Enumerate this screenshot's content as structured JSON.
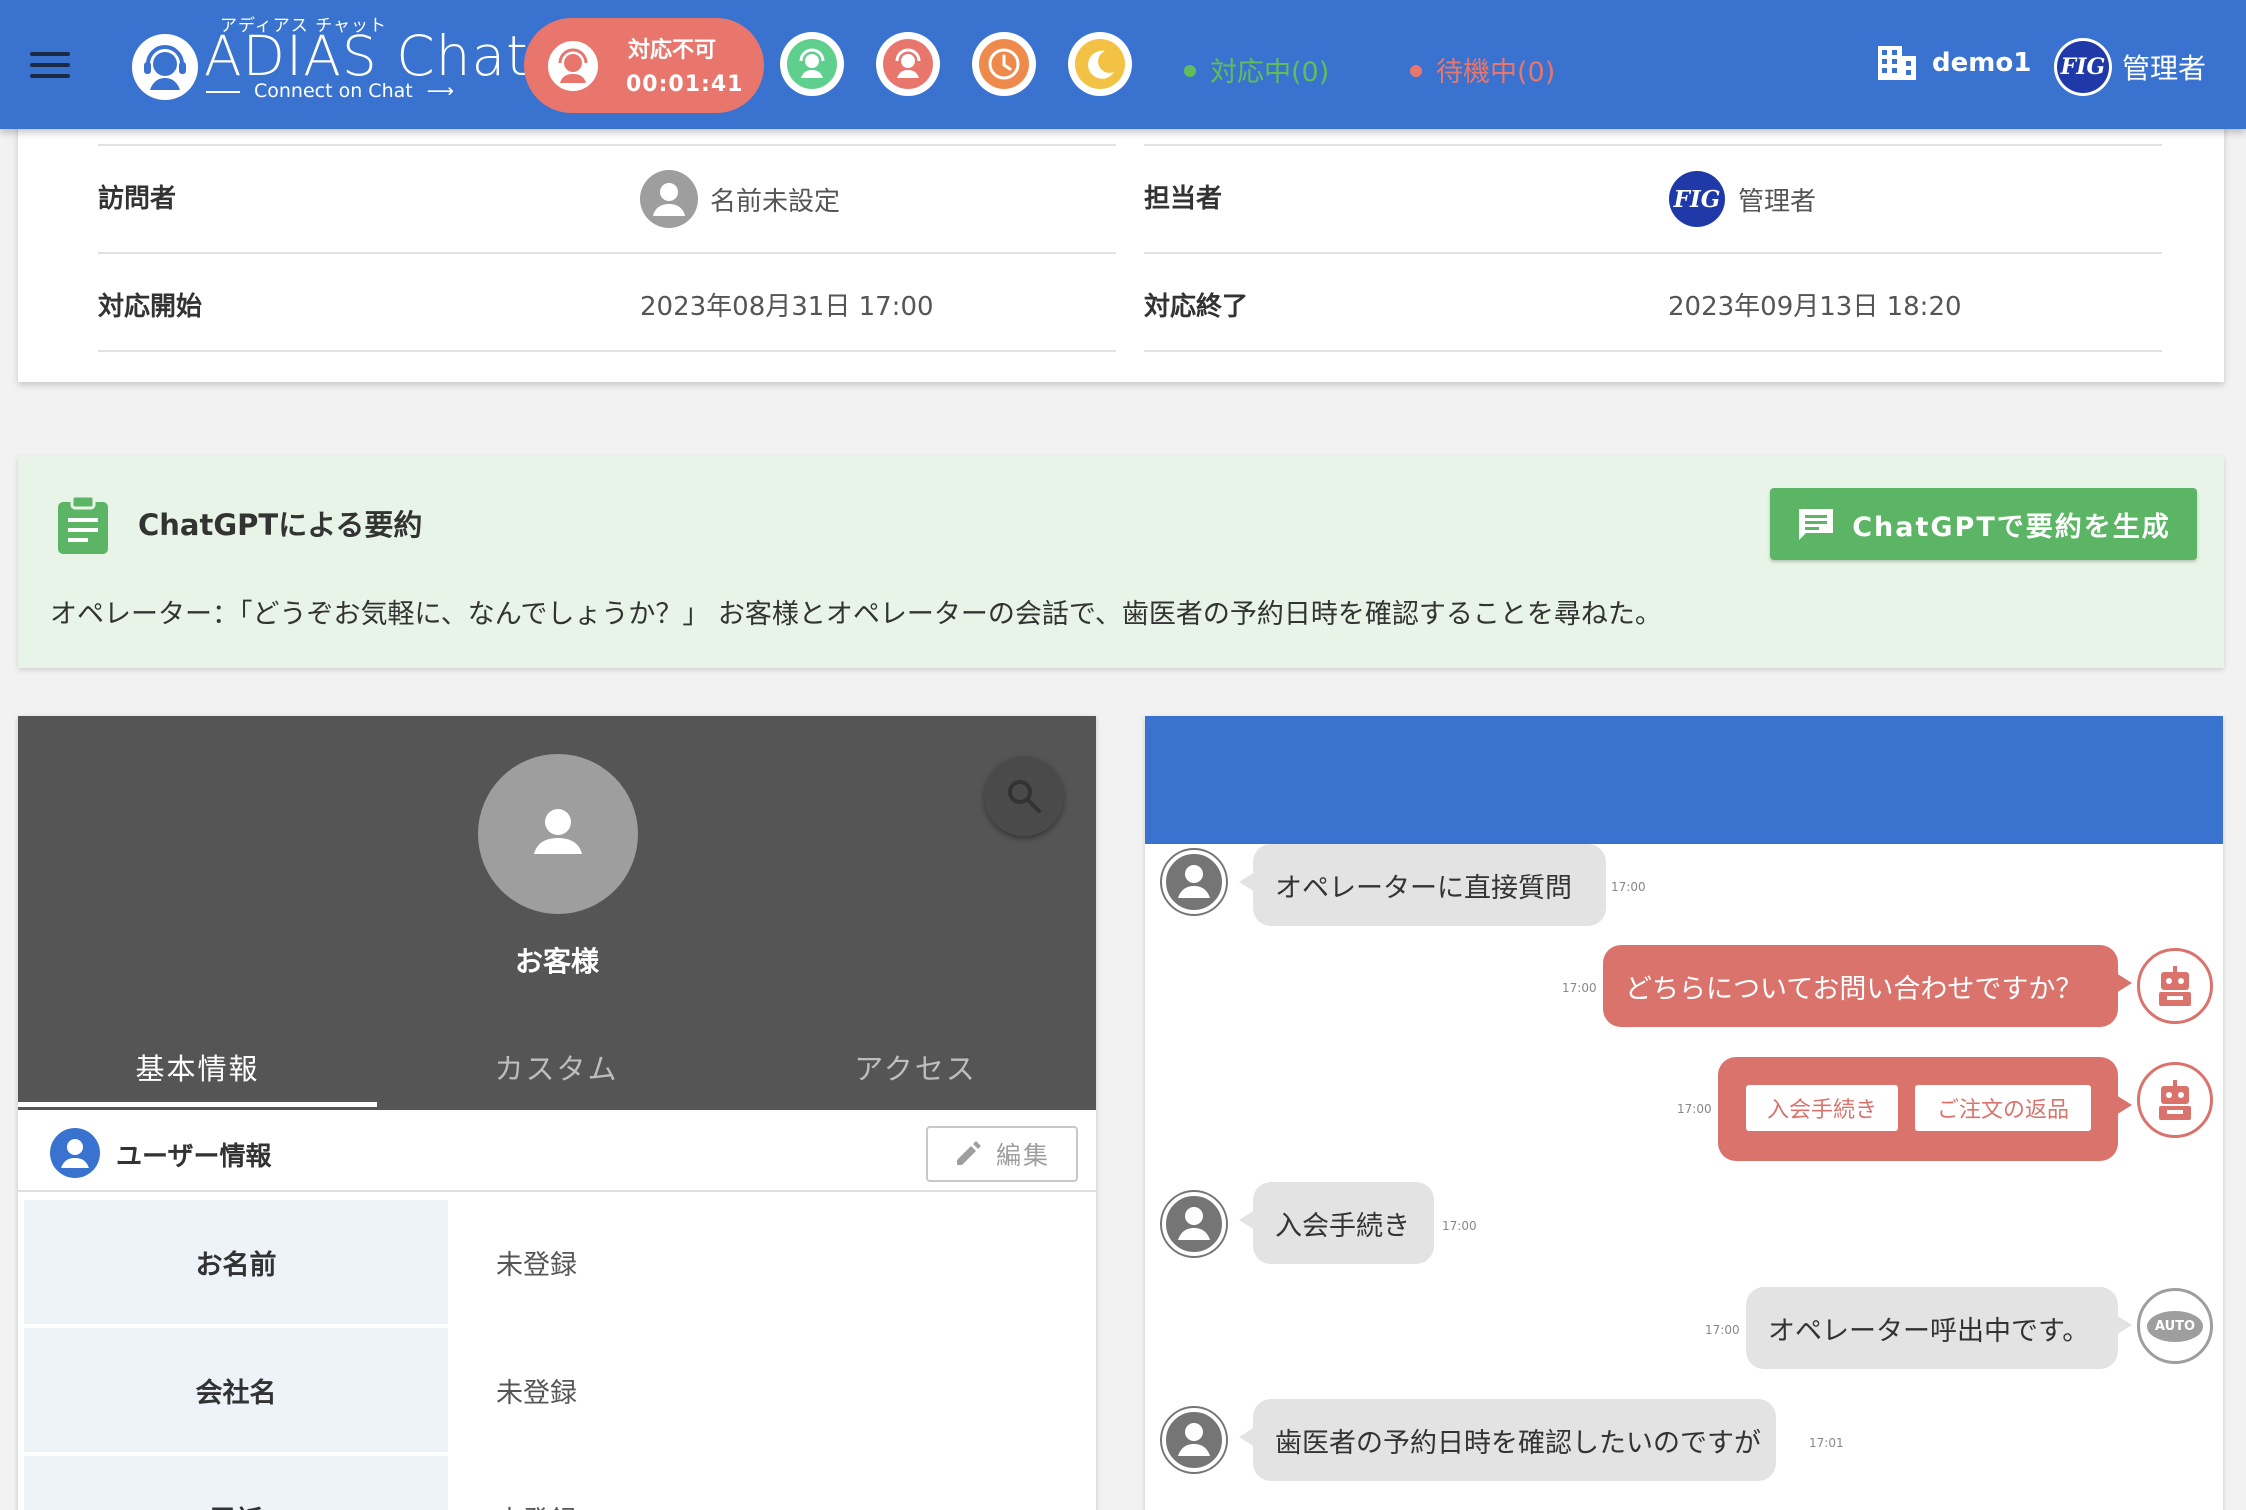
{
  "header": {
    "menu_icon": "hamburger-icon",
    "logo": {
      "sub": "アディアス チャット",
      "main": "ADIAS Chat",
      "tagline": "Connect on Chat"
    },
    "status": {
      "label": "対応不可",
      "timer": "00:01:41",
      "color": "#e8766d"
    },
    "status_buttons": [
      {
        "icon": "operator-available-icon",
        "color": "#5fcf8e"
      },
      {
        "icon": "operator-unavailable-icon",
        "color": "#e8766d"
      },
      {
        "icon": "clock-icon",
        "color": "#ef8a4d"
      },
      {
        "icon": "moon-icon",
        "color": "#f3c244"
      }
    ],
    "counts": {
      "active": {
        "label": "対応中(0)",
        "color": "#5fbe5a"
      },
      "waiting": {
        "label": "待機中(0)",
        "color": "#e8766d"
      }
    },
    "tenant": "demo1",
    "user": "管理者",
    "user_logo_text": "FIG"
  },
  "info": {
    "visitor_label": "訪問者",
    "visitor_value": "名前未設定",
    "assignee_label": "担当者",
    "assignee_value": "管理者",
    "assignee_logo": "FIG",
    "start_label": "対応開始",
    "start_value": "2023年08月31日 17:00",
    "end_label": "対応終了",
    "end_value": "2023年09月13日 18:20"
  },
  "summary": {
    "title": "ChatGPTによる要約",
    "generate_button": "ChatGPTで要約を生成",
    "text": "オペレーター：「どうぞお気軽に、なんでしょうか？」 お客様とオペレーターの会話で、歯医者の予約日時を確認することを尋ねた。",
    "bg_color": "#e9f4e8",
    "button_color": "#5cb565"
  },
  "customer": {
    "name": "お客様",
    "tabs": [
      "基本情報",
      "カスタム",
      "アクセス"
    ],
    "section_title": "ユーザー情報",
    "edit_button": "編集",
    "fields": [
      {
        "label": "お名前",
        "value": "未登録"
      },
      {
        "label": "会社名",
        "value": "未登録"
      },
      {
        "label": "電話",
        "value": "未登録"
      }
    ]
  },
  "chat": {
    "messages": [
      {
        "sender": "customer",
        "text": "オペレーターに直接質問",
        "time": "17:00"
      },
      {
        "sender": "bot",
        "text": "どちらについてお問い合わせですか？",
        "time": "17:00"
      },
      {
        "sender": "bot",
        "type": "choices",
        "choices": [
          "入会手続き",
          "ご注文の返品"
        ],
        "time": "17:00"
      },
      {
        "sender": "customer",
        "text": "入会手続き",
        "time": "17:00"
      },
      {
        "sender": "auto",
        "text": "オペレーター呼出中です。",
        "time": "17:00",
        "avatar_label": "AUTO"
      },
      {
        "sender": "customer",
        "text": "歯医者の予約日時を確認したいのですが",
        "time": "17:01"
      }
    ]
  }
}
